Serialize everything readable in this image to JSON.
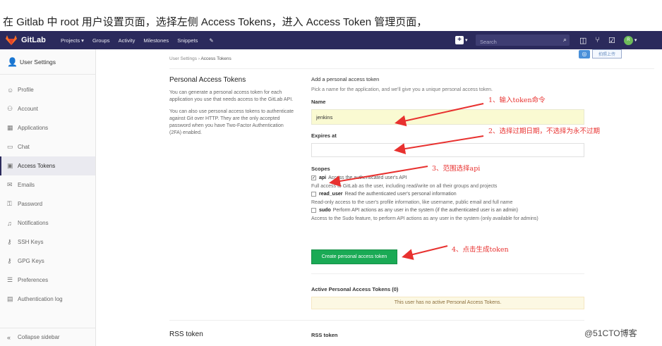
{
  "caption": {
    "text": "在 Gitlab 中 root 用户设置页面，选择左侧 Access Tokens，进入 Access Token 管理页面，"
  },
  "navbar": {
    "brand": "GitLab",
    "items": [
      "Projects ▾",
      "Groups",
      "Activity",
      "Milestones",
      "Snippets"
    ],
    "search_placeholder": "Search",
    "avatar_text": "R"
  },
  "sidebar": {
    "header": "User Settings",
    "items": [
      {
        "label": "Profile",
        "icon": "profile-icon"
      },
      {
        "label": "Account",
        "icon": "account-icon"
      },
      {
        "label": "Applications",
        "icon": "applications-icon"
      },
      {
        "label": "Chat",
        "icon": "chat-icon"
      },
      {
        "label": "Access Tokens",
        "icon": "token-icon",
        "active": true
      },
      {
        "label": "Emails",
        "icon": "email-icon"
      },
      {
        "label": "Password",
        "icon": "lock-icon"
      },
      {
        "label": "Notifications",
        "icon": "bell-icon"
      },
      {
        "label": "SSH Keys",
        "icon": "key-icon"
      },
      {
        "label": "GPG Keys",
        "icon": "key-icon"
      },
      {
        "label": "Preferences",
        "icon": "preferences-icon"
      },
      {
        "label": "Authentication log",
        "icon": "log-icon"
      }
    ],
    "collapse": "Collapse sidebar"
  },
  "breadcrumb": {
    "parent": "User Settings",
    "current": "Access Tokens"
  },
  "upload": {
    "label": "拍照上传"
  },
  "intro": {
    "title": "Personal Access Tokens",
    "p1": "You can generate a personal access token for each application you use that needs access to the GitLab API.",
    "p2": "You can also use personal access tokens to authenticate against Git over HTTP. They are the only accepted password when you have Two-Factor Authentication (2FA) enabled."
  },
  "form": {
    "heading": "Add a personal access token",
    "hint": "Pick a name for the application, and we'll give you a unique personal access token.",
    "name_label": "Name",
    "name_value": "jenkins",
    "expires_label": "Expires at",
    "scopes_label": "Scopes",
    "scopes": [
      {
        "name": "api",
        "desc": "Access the authenticated user's API",
        "checked": true,
        "detail": "Full access to GitLab as the user, including read/write on all their groups and projects"
      },
      {
        "name": "read_user",
        "desc": "Read the authenticated user's personal information",
        "checked": false,
        "detail": "Read-only access to the user's profile information, like username, public email and full name"
      },
      {
        "name": "sudo",
        "desc": "Perform API actions as any user in the system (if the authenticated user is an admin)",
        "checked": false,
        "detail": "Access to the Sudo feature, to perform API actions as any user in the system (only available for admins)"
      }
    ],
    "create_button": "Create personal access token"
  },
  "active_tokens": {
    "title": "Active Personal Access Tokens (0)",
    "empty": "This user has no active Personal Access Tokens."
  },
  "rss": {
    "title": "RSS token",
    "label": "RSS token"
  },
  "annotations": {
    "a1": "1、输入token命令",
    "a2": "2、选择过期日期，不选择为永不过期",
    "a3": "3、范围选择api",
    "a4": "4、点击生成token"
  },
  "watermark": "@51CTO博客",
  "colors": {
    "navbar": "#2b2a5c",
    "create_button": "#1aaa55",
    "annotation": "#e8312f",
    "name_input_bg": "#fafad2"
  }
}
